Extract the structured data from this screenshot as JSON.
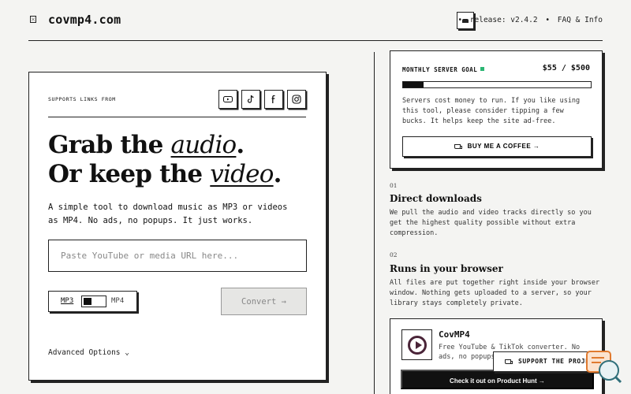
{
  "header": {
    "brand": "covmp4.com",
    "release": "release: v2.4.2",
    "faq": "FAQ & Info",
    "sep": "•"
  },
  "hero": {
    "supports_label": "SUPPORTS LINKS FROM",
    "platforms": [
      "youtube-icon",
      "tiktok-icon",
      "facebook-icon",
      "instagram-icon"
    ],
    "headline_line1_pre": "Grab the ",
    "headline_line1_em": "audio",
    "headline_line1_post": ".",
    "headline_line2_pre": "Or keep the ",
    "headline_line2_em": "video",
    "headline_line2_post": ".",
    "lede": "A simple tool to download music as MP3 or videos as MP4. No ads, no popups. It just works.",
    "url_placeholder": "Paste YouTube or media URL here...",
    "format_mp3": "MP3",
    "format_mp4": "MP4",
    "convert": "Convert →",
    "advanced": "Advanced Options ⌄"
  },
  "goal": {
    "label": "MONTHLY SERVER GOAL",
    "amount": "$55 / $500",
    "progress": 0.11,
    "description": "Servers cost money to run. If you like using this tool, please consider tipping a few bucks. It helps keep the site ad-free.",
    "button": "BUY ME A COFFEE →",
    "accent_color": "#2bb673"
  },
  "features": [
    {
      "num": "01",
      "title": "Direct downloads",
      "desc": "We pull the audio and video tracks directly so you get the highest quality possible without extra compression."
    },
    {
      "num": "02",
      "title": "Runs in your browser",
      "desc": "All files are put together right inside your browser window. Nothing gets uploaded to a server, so your library stays completely private."
    }
  ],
  "promo": {
    "name": "CovMP4",
    "desc": "Free YouTube & TikTok converter. No ads, no popups",
    "button": "Check it out on Product Hunt →",
    "support": "SUPPORT THE PROJECT"
  }
}
